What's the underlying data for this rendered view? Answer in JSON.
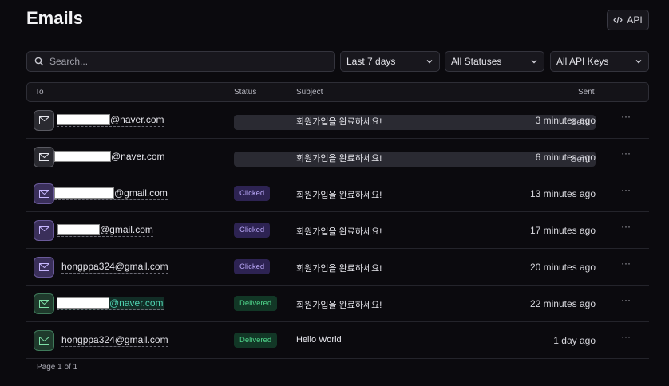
{
  "page": {
    "title": "Emails"
  },
  "header": {
    "api_label": "API",
    "api_icon": "code-icon"
  },
  "filters": {
    "search_placeholder": "Search...",
    "date_range": "Last 7 days",
    "status": "All Statuses",
    "api_keys": "All API Keys"
  },
  "table": {
    "columns": {
      "to": "To",
      "status": "Status",
      "subject": "Subject",
      "sent": "Sent"
    },
    "rows": [
      {
        "to": "@naver.com",
        "status": "Sent",
        "subject": "회원가입을 완료하세요!",
        "sent": "3 minutes ago",
        "more": "···"
      },
      {
        "to": "@naver.com",
        "status": "Sent",
        "subject": "회원가입을 완료하세요!",
        "sent": "6 minutes ago",
        "more": "···"
      },
      {
        "to": "@gmail.com",
        "status": "Clicked",
        "subject": "회원가입을 완료하세요!",
        "sent": "13 minutes ago",
        "more": "···"
      },
      {
        "to": "@gmail.com",
        "status": "Clicked",
        "subject": "회원가입을 완료하세요!",
        "sent": "17 minutes ago",
        "more": "···"
      },
      {
        "to": "hongppa324@gmail.com",
        "status": "Clicked",
        "subject": "회원가입을 완료하세요!",
        "sent": "20 minutes ago",
        "more": "···"
      },
      {
        "to": "@naver.com",
        "status": "Delivered",
        "subject": "회원가입을 완료하세요!",
        "sent": "22 minutes ago",
        "more": "···"
      },
      {
        "to": "hongppa324@gmail.com",
        "status": "Delivered",
        "subject": "Hello World",
        "sent": "1 day ago",
        "more": "···"
      }
    ]
  },
  "pagination": {
    "label": "Page 1 of 1"
  },
  "colors": {
    "sent": "#2a2a32",
    "clicked": "#2d2352",
    "delivered": "#123726",
    "background": "#0b0a0e"
  }
}
